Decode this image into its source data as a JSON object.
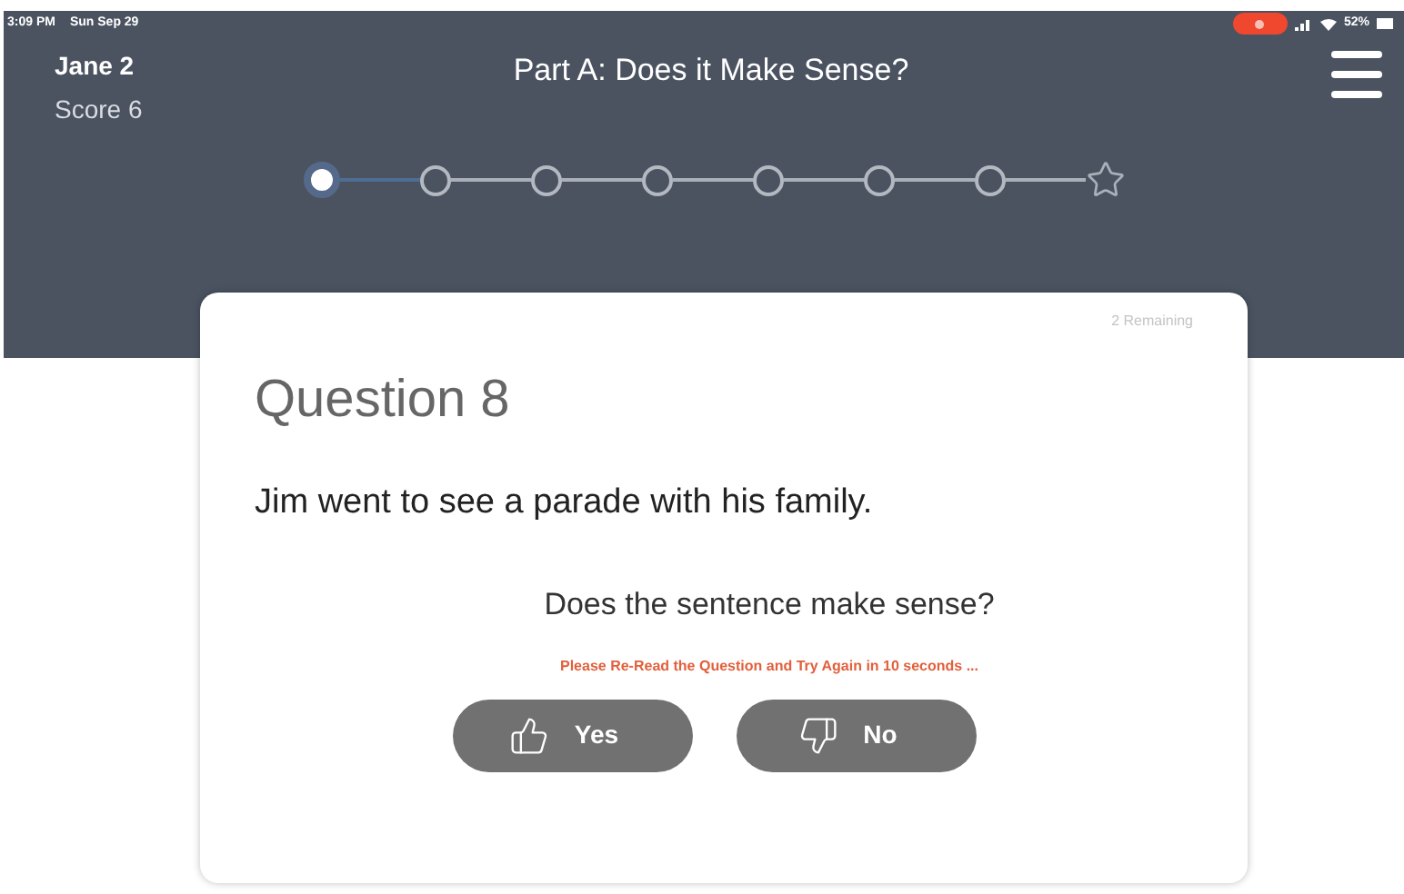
{
  "status_bar": {
    "time": "3:09 PM",
    "date": "Sun Sep 29",
    "recording": true,
    "battery": "52%"
  },
  "header": {
    "user": "Jane 2",
    "score": "Score 6",
    "title": "Part A: Does it Make Sense?"
  },
  "progress": [
    {
      "kind": "step",
      "selected": true
    },
    {
      "kind": "step",
      "selected": false
    },
    {
      "kind": "step",
      "selected": false
    },
    {
      "kind": "step",
      "selected": false
    },
    {
      "kind": "step",
      "selected": false
    },
    {
      "kind": "step",
      "selected": false
    },
    {
      "kind": "step",
      "selected": false
    },
    {
      "kind": "goal",
      "selected": false
    }
  ],
  "card": {
    "remaining": "2 Remaining",
    "heading": "Question 8",
    "sentence": "Jim went to see a parade with his family.",
    "prompt": "Does the sentence make sense?",
    "warning": "Please Re-Read the Question and Try Again in 10 seconds ...",
    "buttons": [
      {
        "kind": "yes",
        "label": "Yes"
      },
      {
        "kind": "no",
        "label": "No"
      }
    ]
  }
}
